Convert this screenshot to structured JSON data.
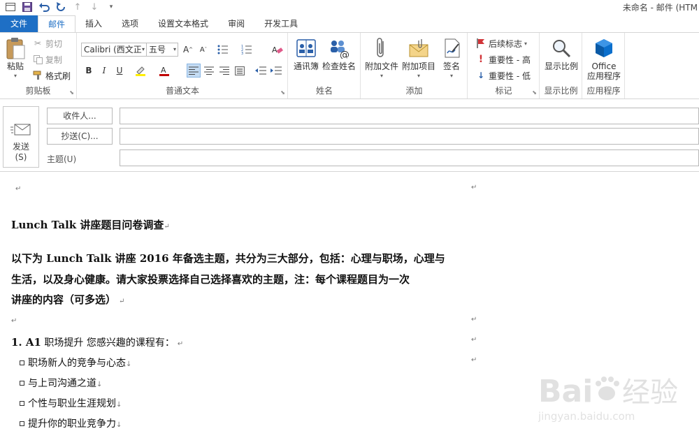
{
  "window": {
    "title": "未命名 - 邮件 (HTM"
  },
  "qat": {
    "icons": [
      "window-icon",
      "save-icon",
      "undo-icon",
      "redo-icon",
      "up-icon",
      "down-icon",
      "customize-icon"
    ]
  },
  "tabs": [
    {
      "label": "文件"
    },
    {
      "label": "邮件"
    },
    {
      "label": "插入"
    },
    {
      "label": "选项"
    },
    {
      "label": "设置文本格式"
    },
    {
      "label": "审阅"
    },
    {
      "label": "开发工具"
    }
  ],
  "ribbon": {
    "clipboard": {
      "label": "剪贴板",
      "paste": "粘贴",
      "cut": "剪切",
      "copy": "复制",
      "format_painter": "格式刷"
    },
    "basic_text": {
      "label": "普通文本",
      "font": "Calibri (西文正",
      "size": "五号"
    },
    "names": {
      "label": "姓名",
      "address_book": "通讯簿",
      "check_names": "检查姓名"
    },
    "include": {
      "label": "添加",
      "attach_file": "附加文件",
      "attach_item": "附加项目",
      "signature": "签名"
    },
    "tags": {
      "label": "标记",
      "follow_up": "后续标志",
      "high_importance": "重要性 - 高",
      "low_importance": "重要性 - 低"
    },
    "zoom": {
      "label": "显示比例",
      "zoom_btn": "显示比例"
    },
    "apps": {
      "label": "应用程序",
      "office_line1": "Office",
      "office_line2": "应用程序"
    }
  },
  "header": {
    "send_line1": "发送",
    "send_line2": "(S)",
    "to_button": "收件人...",
    "cc_button": "抄送(C)...",
    "subject_label": "主题(U)"
  },
  "body": {
    "title": "Lunch Talk  讲座题目问卷调查",
    "intro_line1": "以下为 Lunch Talk  讲座 2016 年备选主题，共分为三大部分，包括：心理与职场，心理与",
    "intro_line2": "生活，以及身心健康。请大家投票选择自己选择喜欢的主题，注：每个课程题目为一次",
    "intro_line3": "讲座的内容（可多选）",
    "question_num": "1. A1",
    "question_text": " 职场提升  您感兴趣的课程有：",
    "options": [
      "职场新人的竞争与心态",
      "与上司沟通之道",
      "个性与职业生涯规划",
      "提升你的职业竞争力"
    ],
    "para_mark": "↵",
    "line_break": "↓"
  },
  "watermark": {
    "brand": "Bai",
    "brand2": "du",
    "cn": "经验",
    "url": "jingyan.baidu.com"
  },
  "colors": {
    "accent": "#1e6fc5",
    "flag_red": "#d13438",
    "office_blue": "#0b6fcc"
  }
}
